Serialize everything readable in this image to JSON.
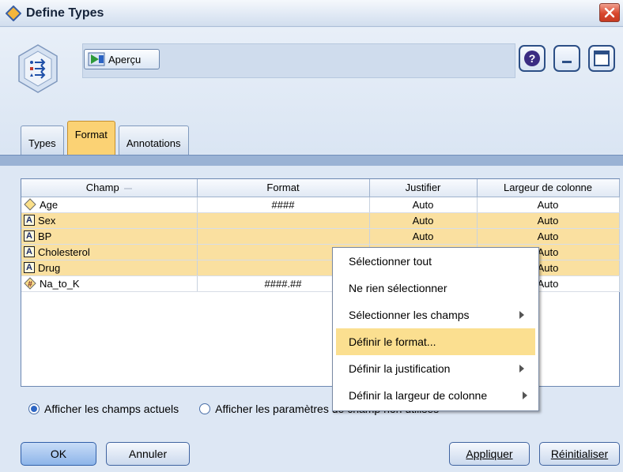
{
  "window": {
    "title": "Define Types"
  },
  "toolbar": {
    "preview_label": "Aperçu"
  },
  "tabs": [
    {
      "label": "Types",
      "active": false
    },
    {
      "label": "Format",
      "active": true
    },
    {
      "label": "Annotations",
      "active": false
    }
  ],
  "table": {
    "columns": [
      "Champ",
      "Format",
      "Justifier",
      "Largeur de colonne"
    ],
    "rows": [
      {
        "field": "Age",
        "type_icon": "continuous-diamond-icon",
        "format": "####",
        "justify": "Auto",
        "width": "Auto",
        "highlighted": false
      },
      {
        "field": "Sex",
        "type_icon": "text-a-icon",
        "format": "",
        "justify": "Auto",
        "width": "Auto",
        "highlighted": true
      },
      {
        "field": "BP",
        "type_icon": "text-a-icon",
        "format": "",
        "justify": "Auto",
        "width": "Auto",
        "highlighted": true
      },
      {
        "field": "Cholesterol",
        "type_icon": "text-a-icon",
        "format": "",
        "justify": "",
        "width": "Auto",
        "highlighted": true
      },
      {
        "field": "Drug",
        "type_icon": "text-a-icon",
        "format": "",
        "justify": "",
        "width": "Auto",
        "highlighted": true
      },
      {
        "field": "Na_to_K",
        "type_icon": "numeric-hash-icon",
        "format": "####.##",
        "justify": "",
        "width": "Auto",
        "highlighted": false
      }
    ]
  },
  "options": {
    "current_fields": "Afficher les champs actuels",
    "unused_fields": "Afficher les paramètres de champ non utilisés"
  },
  "buttons": {
    "ok": "OK",
    "cancel": "Annuler",
    "apply": "Appliquer",
    "reset": "Réinitialiser"
  },
  "context_menu": {
    "items": [
      {
        "label": "Sélectionner tout",
        "submenu": false
      },
      {
        "label": "Ne rien sélectionner",
        "submenu": false
      },
      {
        "label": "Sélectionner les champs",
        "submenu": true
      },
      {
        "label": "Définir le format...",
        "submenu": false,
        "highlighted": true
      },
      {
        "label": "Définir la justification",
        "submenu": true
      },
      {
        "label": "Définir la largeur de colonne",
        "submenu": true
      }
    ]
  },
  "colors": {
    "highlight_row": "#fae0a0",
    "active_tab": "#fbd274",
    "close_button": "#d9472e"
  }
}
